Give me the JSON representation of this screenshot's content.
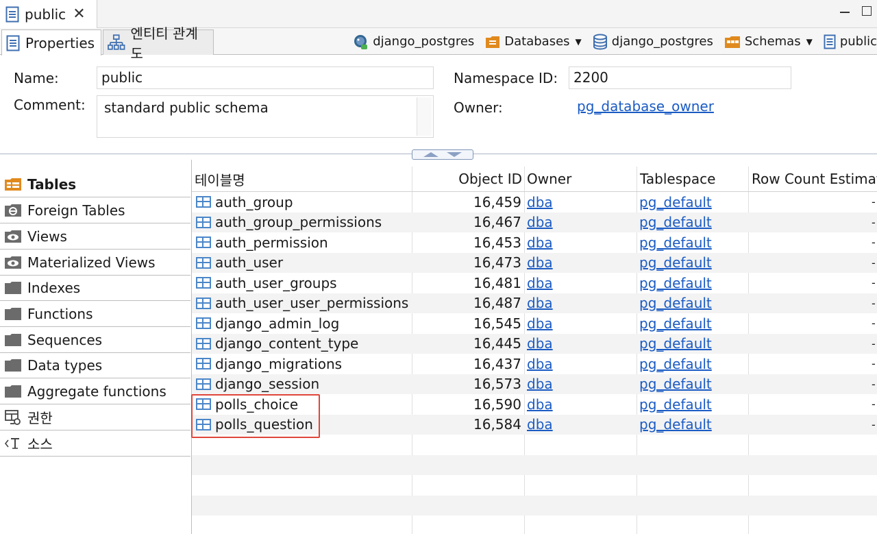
{
  "editor_tab": {
    "title": "public",
    "close": "✕"
  },
  "subtabs": [
    {
      "label": "Properties"
    },
    {
      "label": "엔티티 관계도"
    }
  ],
  "breadcrumbs": [
    {
      "label": "django_postgres",
      "icon": "postgres-elephant-icon",
      "dropdown": false
    },
    {
      "label": "Databases",
      "icon": "folder-databases-icon",
      "dropdown": true
    },
    {
      "label": "django_postgres",
      "icon": "database-icon",
      "dropdown": false
    },
    {
      "label": "Schemas",
      "icon": "schemas-icon",
      "dropdown": true
    },
    {
      "label": "public",
      "icon": "document-icon",
      "dropdown": false
    }
  ],
  "properties": {
    "name_label": "Name:",
    "name_value": "public",
    "comment_label": "Comment:",
    "comment_value": "standard public schema",
    "namespace_label": "Namespace ID:",
    "namespace_value": "2200",
    "owner_label": "Owner:",
    "owner_value": "pg_database_owner"
  },
  "nav": {
    "items": [
      {
        "label": "Tables",
        "icon": "tables-icon",
        "active": true
      },
      {
        "label": "Foreign Tables",
        "icon": "foreign-table-icon",
        "active": false
      },
      {
        "label": "Views",
        "icon": "view-eye-icon",
        "active": false
      },
      {
        "label": "Materialized Views",
        "icon": "view-eye-icon",
        "active": false
      },
      {
        "label": "Indexes",
        "icon": "folder-icon",
        "active": false
      },
      {
        "label": "Functions",
        "icon": "folder-icon",
        "active": false
      },
      {
        "label": "Sequences",
        "icon": "folder-icon",
        "active": false
      },
      {
        "label": "Data types",
        "icon": "folder-icon",
        "active": false
      },
      {
        "label": "Aggregate functions",
        "icon": "folder-icon",
        "active": false
      },
      {
        "label": "권한",
        "icon": "permissions-icon",
        "active": false
      },
      {
        "label": "소스",
        "icon": "source-icon",
        "active": false
      }
    ]
  },
  "grid": {
    "columns": [
      "테이블명",
      "Object ID",
      "Owner",
      "Tablespace",
      "Row Count Estimat"
    ],
    "rows": [
      {
        "name": "auth_group",
        "oid": "16,459",
        "owner": "dba",
        "tablespace": "pg_default",
        "rows": "-"
      },
      {
        "name": "auth_group_permissions",
        "oid": "16,467",
        "owner": "dba",
        "tablespace": "pg_default",
        "rows": "-"
      },
      {
        "name": "auth_permission",
        "oid": "16,453",
        "owner": "dba",
        "tablespace": "pg_default",
        "rows": "-"
      },
      {
        "name": "auth_user",
        "oid": "16,473",
        "owner": "dba",
        "tablespace": "pg_default",
        "rows": "-"
      },
      {
        "name": "auth_user_groups",
        "oid": "16,481",
        "owner": "dba",
        "tablespace": "pg_default",
        "rows": "-"
      },
      {
        "name": "auth_user_user_permissions",
        "oid": "16,487",
        "owner": "dba",
        "tablespace": "pg_default",
        "rows": "-"
      },
      {
        "name": "django_admin_log",
        "oid": "16,545",
        "owner": "dba",
        "tablespace": "pg_default",
        "rows": "-"
      },
      {
        "name": "django_content_type",
        "oid": "16,445",
        "owner": "dba",
        "tablespace": "pg_default",
        "rows": "-"
      },
      {
        "name": "django_migrations",
        "oid": "16,437",
        "owner": "dba",
        "tablespace": "pg_default",
        "rows": "-"
      },
      {
        "name": "django_session",
        "oid": "16,573",
        "owner": "dba",
        "tablespace": "pg_default",
        "rows": "-"
      },
      {
        "name": "polls_choice",
        "oid": "16,590",
        "owner": "dba",
        "tablespace": "pg_default",
        "rows": "-"
      },
      {
        "name": "polls_question",
        "oid": "16,584",
        "owner": "dba",
        "tablespace": "pg_default",
        "rows": "-"
      }
    ]
  },
  "colors": {
    "link": "#1a5bc4",
    "highlight": "#e0453a",
    "table_icon": "#4b86c8",
    "folder": "#6b6b6b",
    "orange": "#e08a1e"
  }
}
